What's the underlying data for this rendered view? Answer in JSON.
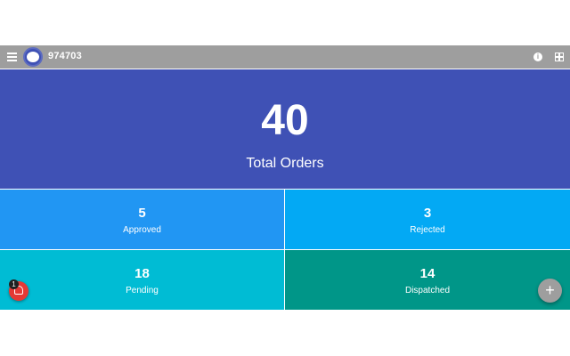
{
  "appbar": {
    "title": "974703",
    "menu_icon": "menu-icon",
    "info_icon": "info-icon",
    "info_glyph": "i",
    "grid_icon": "grid-icon",
    "color": "#9e9e9e"
  },
  "tiles": {
    "total": {
      "value": "40",
      "label": "Total Orders",
      "color": "#3f51b5"
    },
    "approved": {
      "value": "5",
      "label": "Approved",
      "color": "#2196f3"
    },
    "rejected": {
      "value": "3",
      "label": "Rejected",
      "color": "#03a9f4"
    },
    "pending": {
      "value": "18",
      "label": "Pending",
      "color": "#00bcd4"
    },
    "dispatched": {
      "value": "14",
      "label": "Dispatched",
      "color": "#009688"
    }
  },
  "notification": {
    "count": "1",
    "icon": "bell-icon",
    "color": "#e53935"
  },
  "fab": {
    "glyph": "+",
    "icon": "plus-icon"
  }
}
